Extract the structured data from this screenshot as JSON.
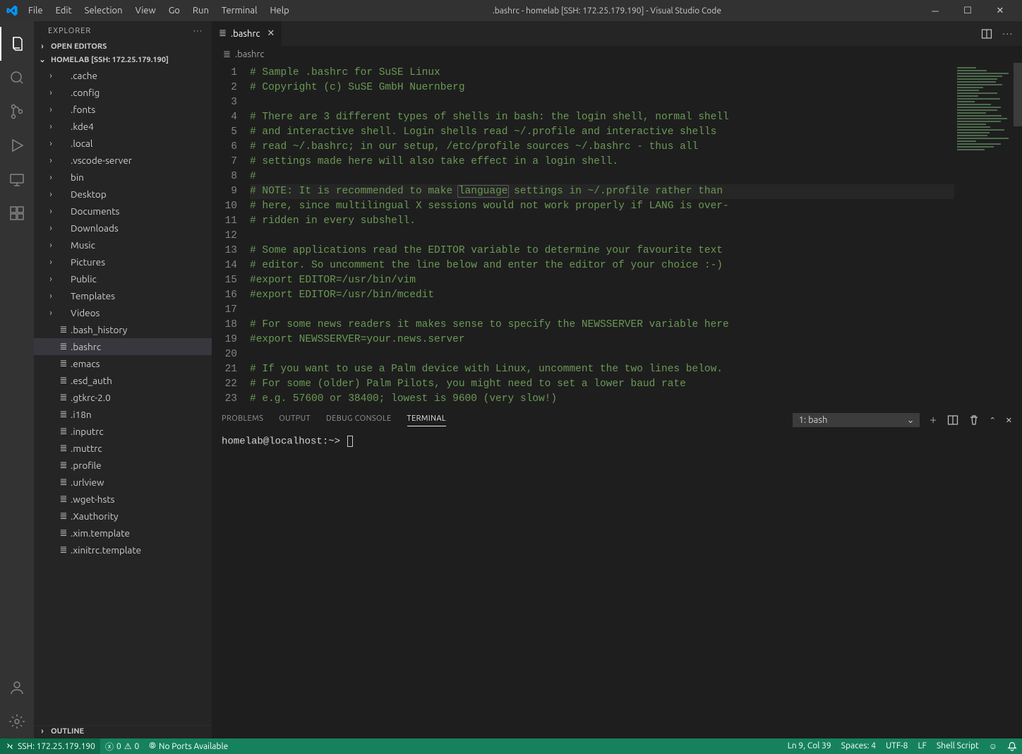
{
  "title": ".bashrc - homelab [SSH: 172.25.179.190] - Visual Studio Code",
  "menu": [
    "File",
    "Edit",
    "Selection",
    "View",
    "Go",
    "Run",
    "Terminal",
    "Help"
  ],
  "sidebar": {
    "title": "EXPLORER",
    "sections": {
      "open_editors": "OPEN EDITORS",
      "workspace": "HOMELAB [SSH: 172.25.179.190]",
      "outline": "OUTLINE"
    },
    "tree": [
      {
        "kind": "folder",
        "name": ".cache"
      },
      {
        "kind": "folder",
        "name": ".config"
      },
      {
        "kind": "folder",
        "name": ".fonts"
      },
      {
        "kind": "folder",
        "name": ".kde4"
      },
      {
        "kind": "folder",
        "name": ".local"
      },
      {
        "kind": "folder",
        "name": ".vscode-server"
      },
      {
        "kind": "folder",
        "name": "bin"
      },
      {
        "kind": "folder",
        "name": "Desktop"
      },
      {
        "kind": "folder",
        "name": "Documents"
      },
      {
        "kind": "folder",
        "name": "Downloads"
      },
      {
        "kind": "folder",
        "name": "Music"
      },
      {
        "kind": "folder",
        "name": "Pictures"
      },
      {
        "kind": "folder",
        "name": "Public"
      },
      {
        "kind": "folder",
        "name": "Templates"
      },
      {
        "kind": "folder",
        "name": "Videos"
      },
      {
        "kind": "file",
        "name": ".bash_history"
      },
      {
        "kind": "file",
        "name": ".bashrc",
        "selected": true
      },
      {
        "kind": "file",
        "name": ".emacs"
      },
      {
        "kind": "file",
        "name": ".esd_auth"
      },
      {
        "kind": "file",
        "name": ".gtkrc-2.0"
      },
      {
        "kind": "file",
        "name": ".i18n"
      },
      {
        "kind": "file",
        "name": ".inputrc"
      },
      {
        "kind": "file",
        "name": ".muttrc"
      },
      {
        "kind": "file",
        "name": ".profile"
      },
      {
        "kind": "file",
        "name": ".urlview"
      },
      {
        "kind": "file",
        "name": ".wget-hsts"
      },
      {
        "kind": "file",
        "name": ".Xauthority"
      },
      {
        "kind": "file",
        "name": ".xim.template"
      },
      {
        "kind": "file",
        "name": ".xinitrc.template"
      }
    ]
  },
  "tab": {
    "filename": ".bashrc"
  },
  "breadcrumb": ".bashrc",
  "code": {
    "highlight_line": 9,
    "highlight_word": "language",
    "lines": [
      "# Sample .bashrc for SuSE Linux",
      "# Copyright (c) SuSE GmbH Nuernberg",
      "",
      "# There are 3 different types of shells in bash: the login shell, normal shell",
      "# and interactive shell. Login shells read ~/.profile and interactive shells",
      "# read ~/.bashrc; in our setup, /etc/profile sources ~/.bashrc - thus all",
      "# settings made here will also take effect in a login shell.",
      "#",
      "# NOTE: It is recommended to make language settings in ~/.profile rather than",
      "# here, since multilingual X sessions would not work properly if LANG is over-",
      "# ridden in every subshell.",
      "",
      "# Some applications read the EDITOR variable to determine your favourite text",
      "# editor. So uncomment the line below and enter the editor of your choice :-)",
      "#export EDITOR=/usr/bin/vim",
      "#export EDITOR=/usr/bin/mcedit",
      "",
      "# For some news readers it makes sense to specify the NEWSSERVER variable here",
      "#export NEWSSERVER=your.news.server",
      "",
      "# If you want to use a Palm device with Linux, uncomment the two lines below.",
      "# For some (older) Palm Pilots, you might need to set a lower baud rate",
      "# e.g. 57600 or 38400; lowest is 9600 (very slow!)"
    ]
  },
  "panel": {
    "tabs": [
      "PROBLEMS",
      "OUTPUT",
      "DEBUG CONSOLE",
      "TERMINAL"
    ],
    "active_tab": "TERMINAL",
    "terminal_selector": "1: bash",
    "prompt": "homelab@localhost:~>"
  },
  "status": {
    "remote": "SSH: 172.25.179.190",
    "errors": "0",
    "warnings": "0",
    "ports": "No Ports Available",
    "ln_col": "Ln 9, Col 39",
    "spaces": "Spaces: 4",
    "encoding": "UTF-8",
    "eol": "LF",
    "language": "Shell Script"
  }
}
